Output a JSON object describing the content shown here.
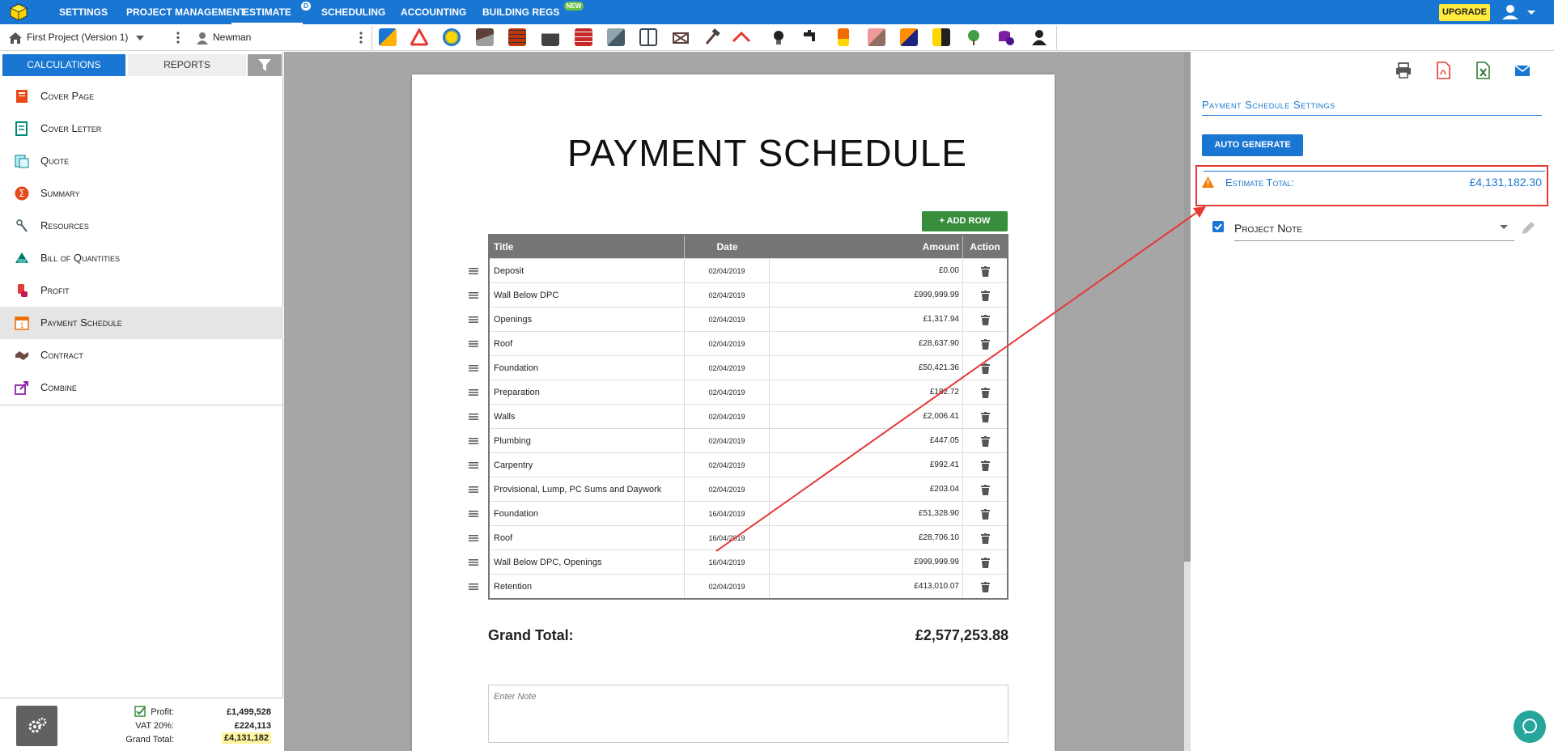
{
  "topnav": {
    "items": [
      "SETTINGS",
      "PROJECT MANAGEMENT",
      "ESTIMATE",
      "SCHEDULING",
      "ACCOUNTING",
      "BUILDING REGS"
    ],
    "estimate_badge": "D",
    "building_regs_badge": "NEW",
    "upgrade_label": "UPGRADE"
  },
  "toolbar": {
    "project": "First Project (Version 1)",
    "pricebook": "Newman"
  },
  "left": {
    "tabs": {
      "calculations": "CALCULATIONS",
      "reports": "REPORTS"
    },
    "items": [
      "Cover Page",
      "Cover Letter",
      "Quote",
      "Summary",
      "Resources",
      "Bill of Quantities",
      "Profit",
      "Payment Schedule",
      "Contract",
      "Combine"
    ],
    "footer": {
      "profit_label": "Profit:",
      "profit_value": "£1,499,528",
      "vat_label": "VAT 20%:",
      "vat_value": "£224,113",
      "grand_label": "Grand Total:",
      "grand_value": "£4,131,182"
    }
  },
  "document": {
    "title": "PAYMENT SCHEDULE",
    "add_row_label": "+ ADD ROW",
    "columns": {
      "title": "Title",
      "date": "Date",
      "amount": "Amount",
      "action": "Action"
    },
    "rows": [
      {
        "title": "Deposit",
        "date": "02/04/2019",
        "amount": "£0.00"
      },
      {
        "title": "Wall Below DPC",
        "date": "02/04/2019",
        "amount": "£999,999.99"
      },
      {
        "title": "Openings",
        "date": "02/04/2019",
        "amount": "£1,317.94"
      },
      {
        "title": "Roof",
        "date": "02/04/2019",
        "amount": "£28,637.90"
      },
      {
        "title": "Foundation",
        "date": "02/04/2019",
        "amount": "£50,421.36"
      },
      {
        "title": "Preparation",
        "date": "02/04/2019",
        "amount": "£182.72"
      },
      {
        "title": "Walls",
        "date": "02/04/2019",
        "amount": "£2,006.41"
      },
      {
        "title": "Plumbing",
        "date": "02/04/2019",
        "amount": "£447.05"
      },
      {
        "title": "Carpentry",
        "date": "02/04/2019",
        "amount": "£992.41"
      },
      {
        "title": "Provisional, Lump, PC Sums and Daywork",
        "date": "02/04/2019",
        "amount": "£203.04"
      },
      {
        "title": "Foundation",
        "date": "16/04/2019",
        "amount": "£51,328.90"
      },
      {
        "title": "Roof",
        "date": "16/04/2019",
        "amount": "£28,706.10"
      },
      {
        "title": "Wall Below DPC, Openings",
        "date": "16/04/2019",
        "amount": "£999,999.99"
      },
      {
        "title": "Retention",
        "date": "02/04/2019",
        "amount": "£413,010.07"
      }
    ],
    "grand_total_label": "Grand Total:",
    "grand_total_value": "£2,577,253.88",
    "note_placeholder": "Enter Note"
  },
  "right": {
    "title": "Payment Schedule Settings",
    "auto_generate": "AUTO GENERATE",
    "estimate_total_label": "Estimate Total:",
    "estimate_total_value": "£4,131,182.30",
    "project_note_label": "Project Note"
  },
  "colors": {
    "brand": "#1976d2",
    "add": "#388e3c",
    "highlight": "#e53935",
    "upgrade": "#ffeb3b"
  }
}
